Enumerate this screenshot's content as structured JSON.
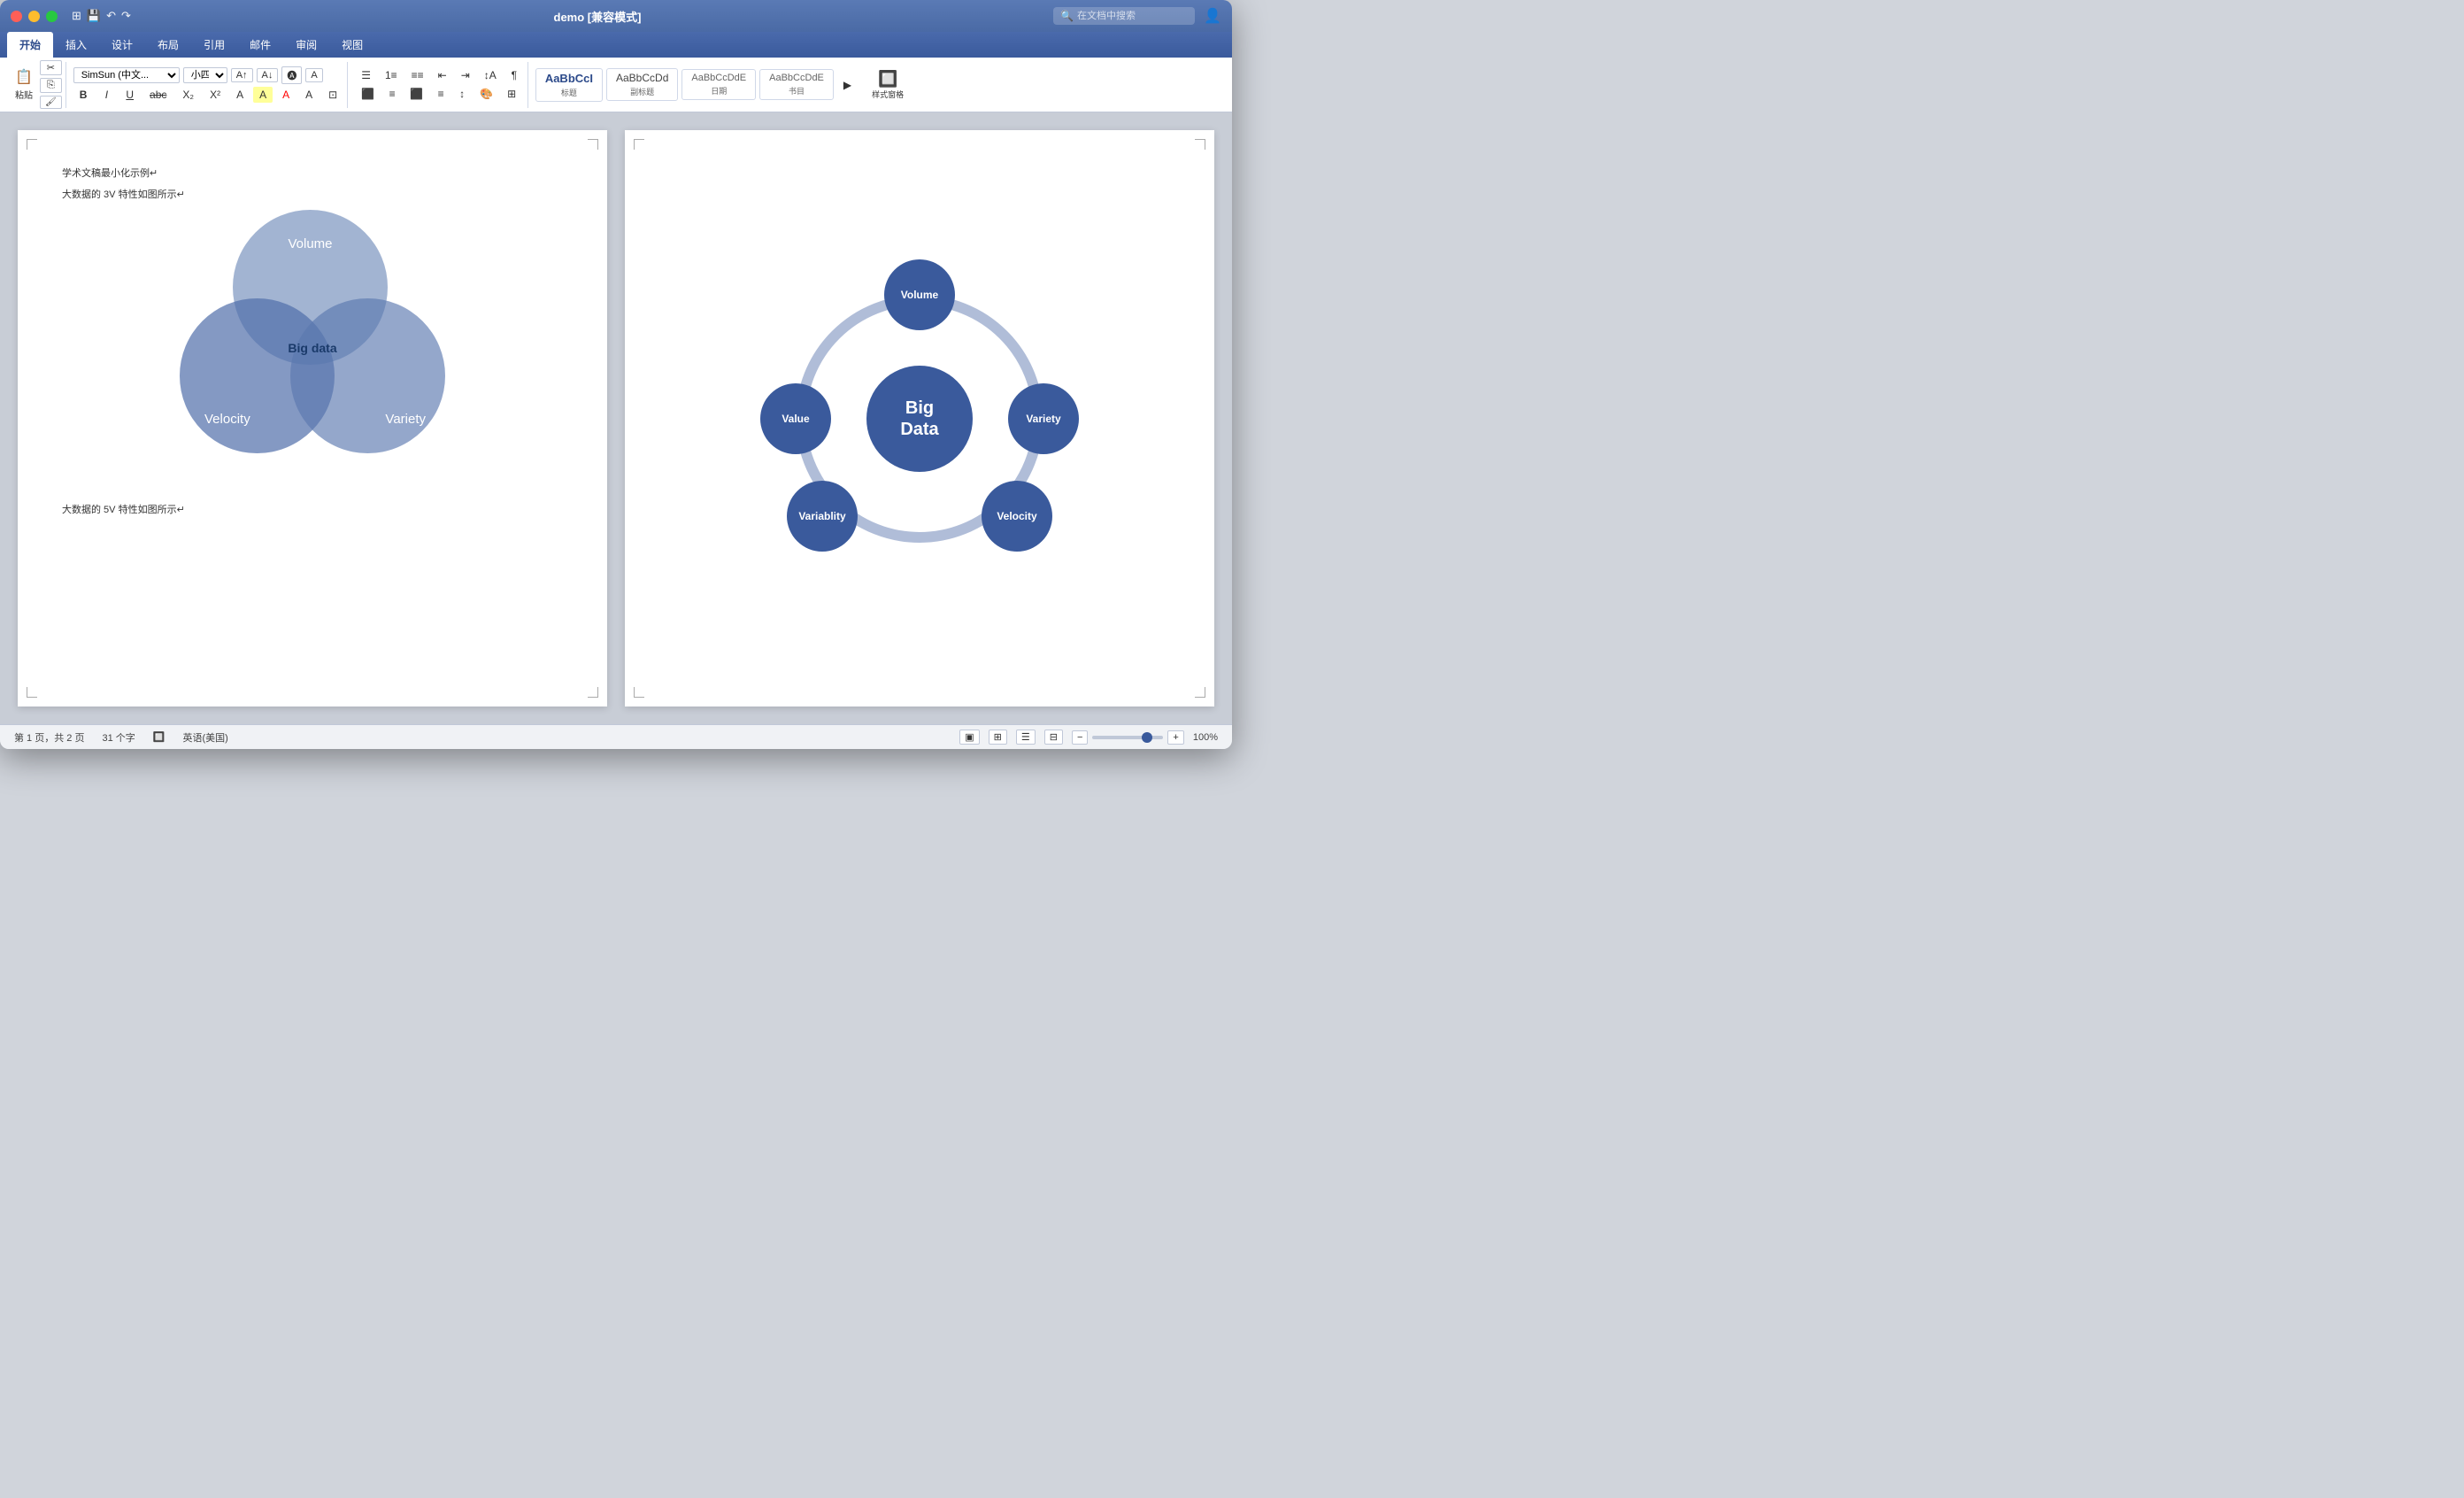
{
  "window": {
    "title": "demo [兼容模式]"
  },
  "titlebar": {
    "title": "demo [兼容模式]",
    "search_placeholder": "在文档中搜索"
  },
  "ribbon": {
    "tabs": [
      "开始",
      "插入",
      "设计",
      "布局",
      "引用",
      "邮件",
      "审阅",
      "视图"
    ],
    "active_tab": "开始",
    "font": "SimSun (中文...",
    "font_size": "小四",
    "styles": [
      {
        "label": "标题",
        "preview": "AaBbCcI"
      },
      {
        "label": "副标题",
        "preview": "AaBbCcDd"
      },
      {
        "label": "日期",
        "preview": "AaBbCcDdE"
      },
      {
        "label": "书目",
        "preview": "AaBbCcDdE"
      }
    ],
    "styles_panel_label": "样式窗格"
  },
  "page1": {
    "text1": "学术文稿最小化示例↵",
    "text2": "大数据的 3V 特性如图所示↵",
    "text3": "大数据的 5V 特性如图所示↵",
    "venn": {
      "volume": "Volume",
      "velocity": "Velocity",
      "variety": "Variety",
      "center": "Big data"
    }
  },
  "page2": {
    "circular": {
      "center": "Big\nData",
      "nodes": [
        "Volume",
        "Variety",
        "Velocity",
        "Variablity",
        "Value"
      ]
    }
  },
  "statusbar": {
    "page_info": "第 1 页，共 2 页",
    "word_count": "31 个字",
    "language": "英语(美国)",
    "zoom": "100%"
  }
}
